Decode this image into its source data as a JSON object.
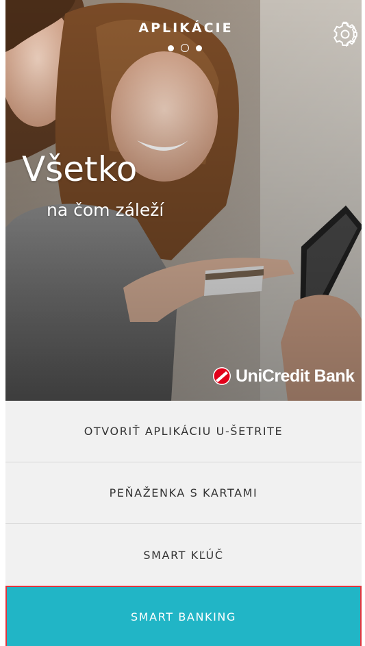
{
  "header": {
    "title": "APLIKÁCIE",
    "page_indicator": {
      "total": 3,
      "current": 2
    },
    "settings_icon": "gear-icon"
  },
  "hero": {
    "headline": "Všetko",
    "subheadline": "na čom záleží",
    "brand_name": "UniCredit Bank",
    "brand_logo": "unicredit-logo",
    "brand_color": "#e2001a"
  },
  "menu": {
    "items": [
      {
        "label": "OTVORIŤ APLIKÁCIU U-ŠETRITE"
      },
      {
        "label": "PEŇAŽENKA S KARTAMI"
      },
      {
        "label": "SMART KĽÚČ"
      },
      {
        "label": "SMART BANKING"
      }
    ],
    "primary_color": "#21b5c6",
    "highlight_border_color": "#e2343d"
  }
}
